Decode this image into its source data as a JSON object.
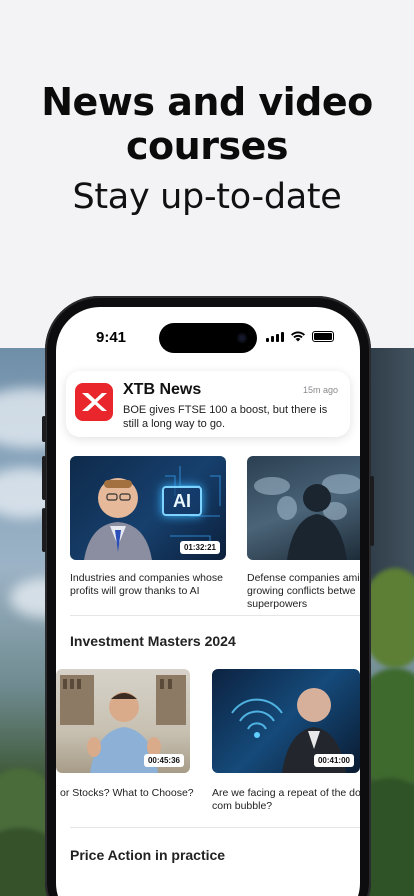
{
  "hero": {
    "headline_line1": "News and video",
    "headline_line2": "courses",
    "subline": "Stay up-to-date"
  },
  "status_bar": {
    "time": "9:41"
  },
  "notification": {
    "app_name": "XTB News",
    "time": "15m ago",
    "body": "BOE gives FTSE 100 a boost, but there is still a long way to go."
  },
  "news_cards": [
    {
      "title": "Industries and companies whose profits will grow thanks to AI",
      "duration": "01:32:21",
      "badge": "AI"
    },
    {
      "title": "Defense companies ami growing conflicts betwe superpowers"
    }
  ],
  "sections": [
    {
      "title": "Investment Masters 2024",
      "cards": [
        {
          "title": "or Stocks? What to Choose?",
          "duration": "00:45:36"
        },
        {
          "title": "Are we facing a repeat of the do com bubble?",
          "duration": "00:41:00"
        }
      ]
    },
    {
      "title": "Price Action in practice",
      "cards": []
    }
  ],
  "colors": {
    "brand_red": "#e8262b",
    "background": "#f3f3f5"
  }
}
